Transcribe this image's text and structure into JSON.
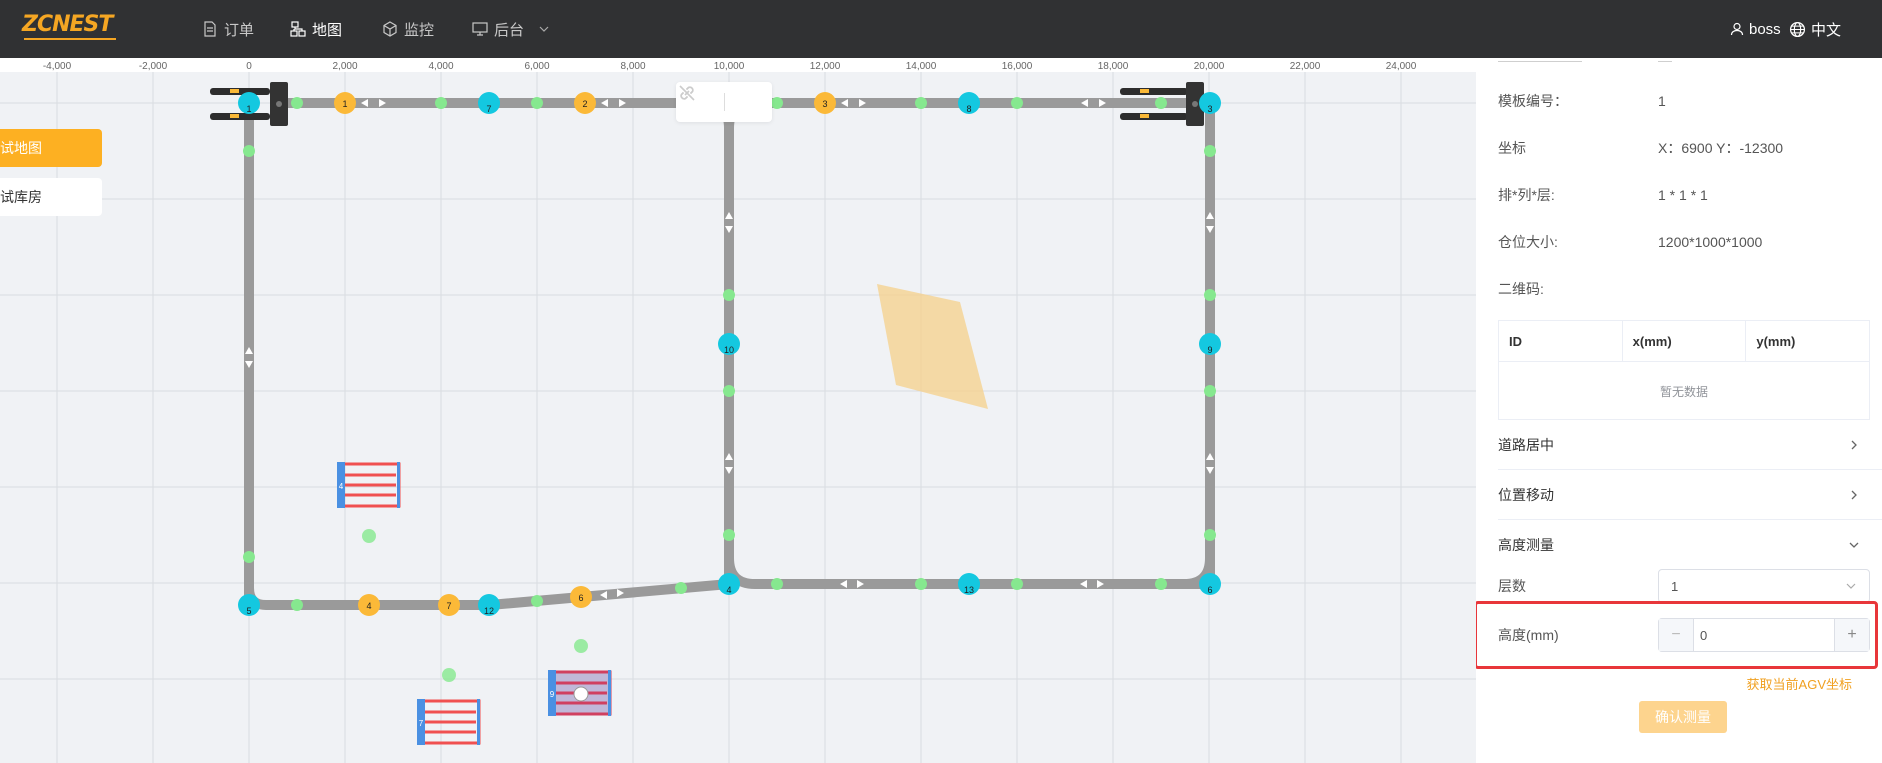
{
  "app": {
    "logo_text": "ZCNEST",
    "accent_color": "#fdb022"
  },
  "nav": {
    "orders": "订单",
    "map": "地图",
    "monitor": "监控",
    "backend": "后台",
    "user": "boss",
    "language": "中文"
  },
  "map": {
    "buttons": {
      "test_map": "试地图",
      "test_warehouse": "试库房"
    },
    "ruler_ticks": [
      "-4,000",
      "-2,000",
      "0",
      "2,000",
      "4,000",
      "6,000",
      "8,000",
      "10,000",
      "12,000",
      "14,000",
      "16,000",
      "18,000",
      "20,000",
      "22,000",
      "24,000"
    ],
    "cyan_nodes": [
      "1",
      "7",
      "8",
      "3",
      "10",
      "9",
      "5",
      "12",
      "4",
      "13",
      "6"
    ],
    "orange_nodes": [
      "1",
      "2",
      "3",
      "4",
      "7",
      "6"
    ],
    "agv_labels": [
      "4",
      "7",
      "9"
    ],
    "colors": {
      "road": "#9a9a9a",
      "cyan_node": "#14c8e0",
      "orange_node": "#fbb938",
      "green_point": "#86e88f",
      "zone": "#f5d08a"
    }
  },
  "panel": {
    "template_no_label": "模板编号：",
    "template_no_value": "1",
    "coord_label": "坐标",
    "coord_value": "X：6900 Y：-12300",
    "layout_label": "排*列*层:",
    "layout_value": "1 * 1 * 1",
    "slot_size_label": "仓位大小:",
    "slot_size_value": "1200*1000*1000",
    "qrcode_label": "二维码:",
    "table": {
      "headers": [
        "ID",
        "x(mm)",
        "y(mm)"
      ],
      "empty_text": "暂无数据"
    },
    "sections": {
      "road_center": "道路居中",
      "position_move": "位置移动",
      "height_measure": "高度测量"
    },
    "layers_label": "层数",
    "layers_value": "1",
    "height_label": "高度(mm)",
    "height_value": "0",
    "get_agv_link": "获取当前AGV坐标",
    "confirm_button": "确认测量"
  }
}
